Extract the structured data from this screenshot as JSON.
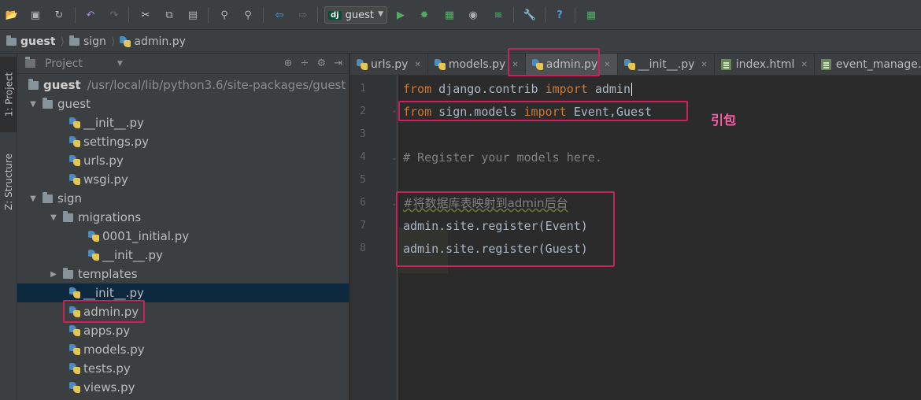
{
  "toolbar": {
    "run_config": "guest",
    "run_config_badge": "dj",
    "icons": [
      "open-folder-icon",
      "save-icon",
      "sync-icon",
      "undo-icon",
      "redo-icon",
      "cut-icon",
      "copy-icon",
      "paste-icon",
      "find-icon",
      "replace-icon",
      "back-icon",
      "forward-icon",
      "run-icon",
      "debug-icon",
      "coverage-icon",
      "profile-icon",
      "run-manage-icon",
      "settings-icon",
      "help-icon",
      "vcs-icon"
    ]
  },
  "breadcrumb": {
    "items": [
      "guest",
      "sign",
      "admin.py"
    ]
  },
  "side_tabs": {
    "project": "1: Project",
    "structure": "Z: Structure"
  },
  "project_panel": {
    "title": "Project",
    "tree": [
      {
        "label": "guest",
        "path": "/usr/local/lib/python3.6/site-packages/guest"
      },
      {
        "label": "guest"
      },
      {
        "label": "__init__.py"
      },
      {
        "label": "settings.py"
      },
      {
        "label": "urls.py"
      },
      {
        "label": "wsgi.py"
      },
      {
        "label": "sign"
      },
      {
        "label": "migrations"
      },
      {
        "label": "0001_initial.py"
      },
      {
        "label": "__init__.py"
      },
      {
        "label": "templates"
      },
      {
        "label": "__init__.py"
      },
      {
        "label": "admin.py"
      },
      {
        "label": "apps.py"
      },
      {
        "label": "models.py"
      },
      {
        "label": "tests.py"
      },
      {
        "label": "views.py"
      }
    ]
  },
  "tabs": [
    {
      "label": "urls.py"
    },
    {
      "label": "models.py"
    },
    {
      "label": "admin.py"
    },
    {
      "label": "__init__.py"
    },
    {
      "label": "index.html"
    },
    {
      "label": "event_manage.html"
    }
  ],
  "editor": {
    "line_numbers": [
      "1",
      "2",
      "3",
      "4",
      "5",
      "6",
      "7",
      "8"
    ],
    "lines": {
      "l1_kw1": "from",
      "l1_mod": " django.contrib ",
      "l1_kw2": "import",
      "l1_name": " admin",
      "l2_kw1": "from",
      "l2_mod": " sign.models ",
      "l2_kw2": "import",
      "l2_name": " Event,Guest",
      "l4_comment": "# Register your models here.",
      "l6_comment": "#将数据库表映射到admin后台",
      "l7": "admin.site.register(Event)",
      "l8": "admin.site.register(Guest)"
    }
  },
  "annotation": {
    "note": "引包",
    "highlight_color": "#c8225a"
  }
}
